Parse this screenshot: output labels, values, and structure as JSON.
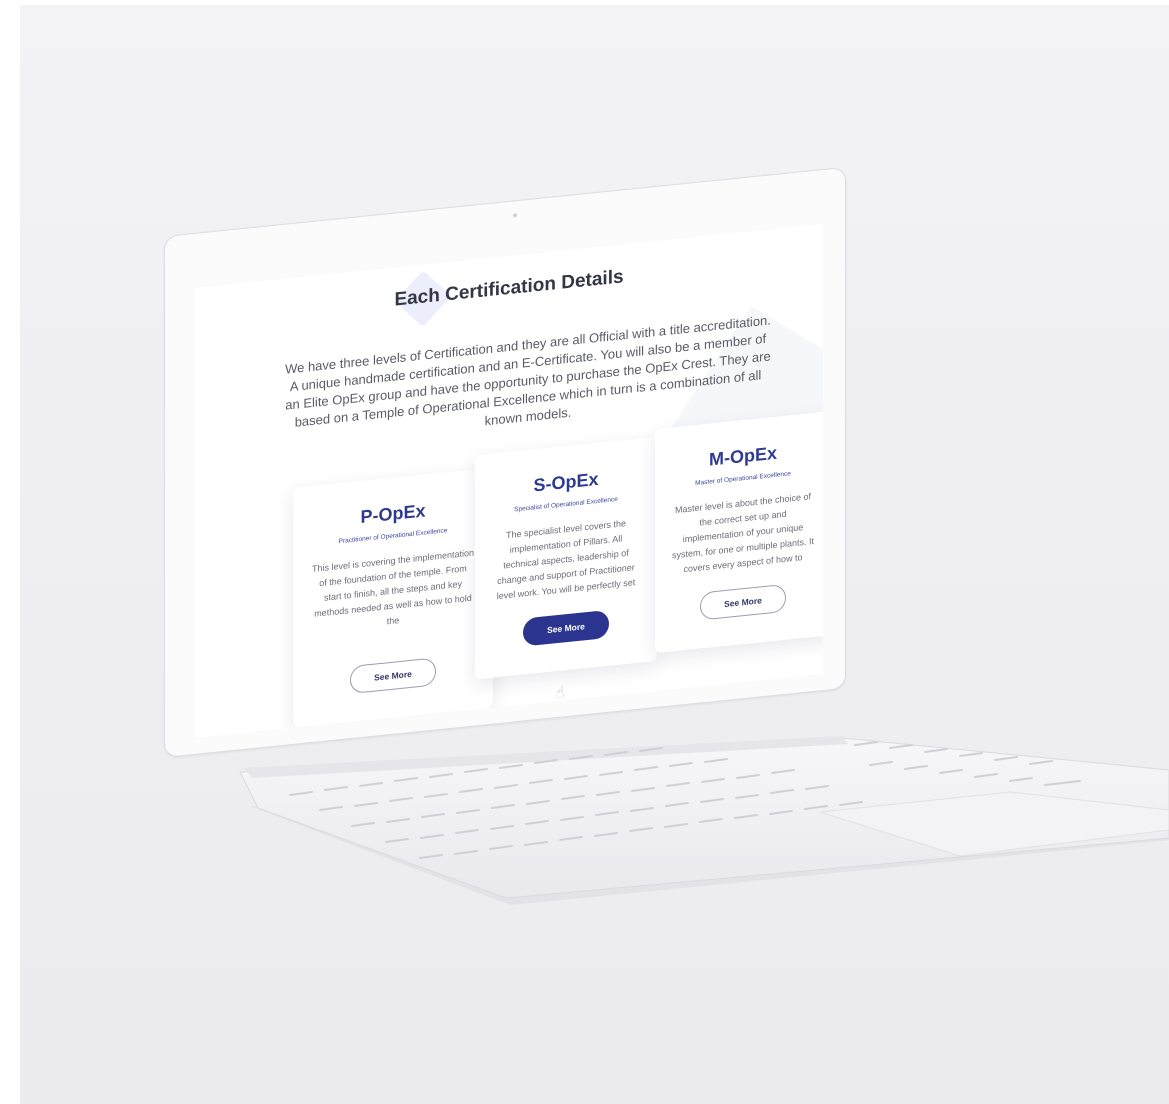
{
  "page": {
    "title": "Each Certification Details",
    "intro": "We have three levels of Certification and they are all Official with a title accreditation. A unique handmade certification and an E-Certificate. You will also be a member of an Elite OpEx group and have the opportunity to purchase the OpEx Crest. They are based on a Temple of Operational Excellence which in turn is a combination of all known models."
  },
  "cards": [
    {
      "title": "P-OpEx",
      "subtitle": "Practitioner of Operational Excellence",
      "body": "This level is covering the implementation of the foundation of the temple. From start to finish, all the steps and key methods needed as well as how to hold the",
      "button": "See More"
    },
    {
      "title": "S-OpEx",
      "subtitle": "Specialist of Operational Excellence",
      "body": "The specialist level covers the implementation of Pillars. All technical aspects, leadership of change and support of Practitioner level work. You will be perfectly set",
      "button": "See More"
    },
    {
      "title": "M-OpEx",
      "subtitle": "Master of Operational Excellence",
      "body": "Master level is about the choice of the correct set up and implementation of your unique system, for one or multiple plants. It covers every aspect of how to",
      "button": "See More"
    }
  ],
  "colors": {
    "accent": "#2b3590",
    "title_text": "#333645",
    "body_text": "#6c6e78"
  }
}
